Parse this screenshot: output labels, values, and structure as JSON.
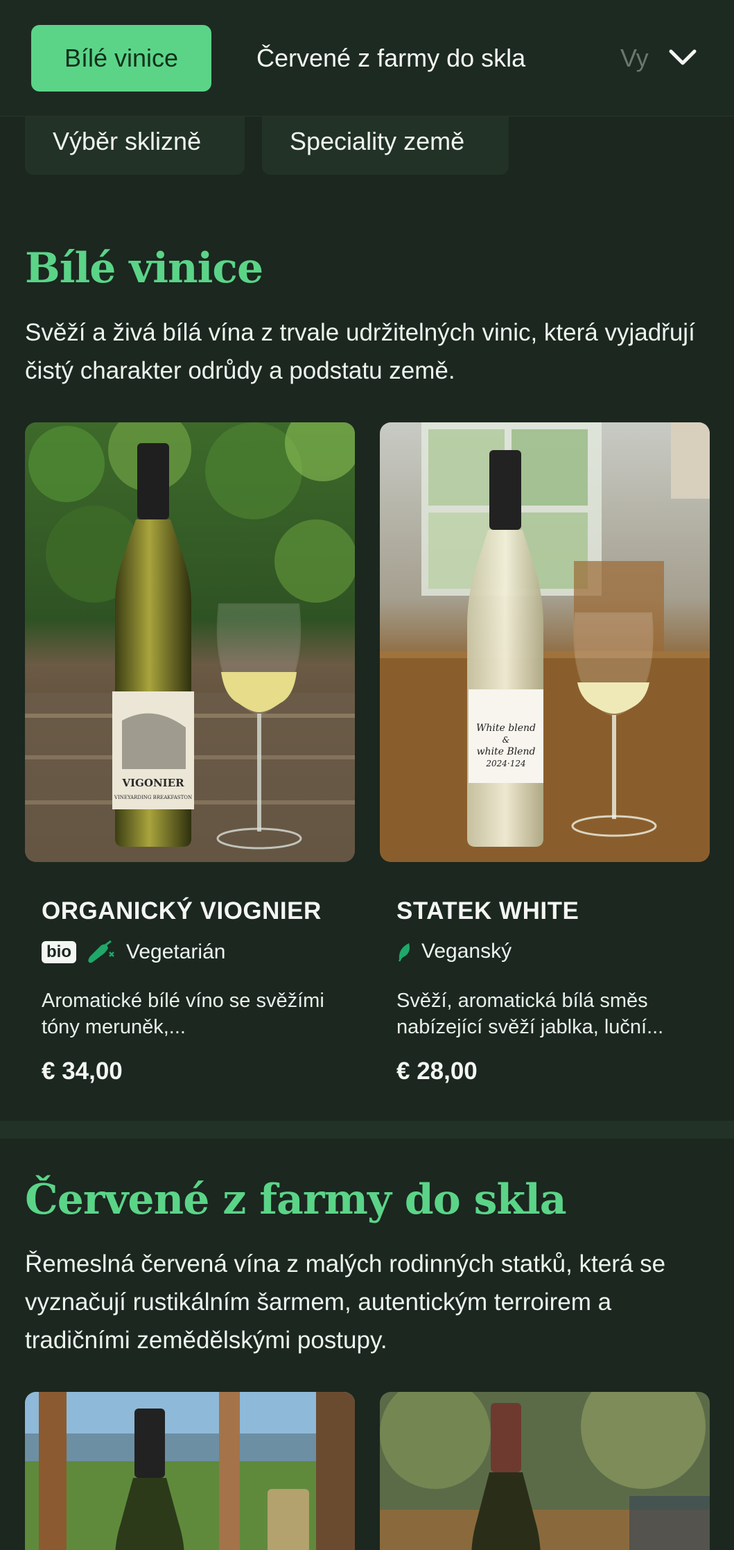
{
  "nav": {
    "tabs": [
      {
        "label": "Bílé vinice"
      },
      {
        "label": "Červené z farmy do skla"
      },
      {
        "label": "Vy"
      }
    ],
    "chips": [
      {
        "label": "Výběr sklizně"
      },
      {
        "label": "Speciality země"
      }
    ]
  },
  "sections": [
    {
      "title": "Bílé vinice",
      "description": "Svěží a živá bílá vína z trvale udržitelných vinic, která vyjadřují čistý charakter odrůdy a podstatu země.",
      "products": [
        {
          "name": "ORGANICKÝ VIOGNIER",
          "badge": "bio",
          "diet": "Vegetarián",
          "description": "Aromatické bílé víno se svěžími tóny meruněk,...",
          "price": "€ 34,00",
          "label_text": "VIGONIER",
          "label_sub": "VINEYARDING BREAKFASTON"
        },
        {
          "name": "STATEK WHITE",
          "diet": "Veganský",
          "description": "Svěží, aromatická bílá směs nabízející svěží jablka, luční...",
          "price": "€ 28,00",
          "label_text": "White blend & white Blend 2024·124"
        }
      ]
    },
    {
      "title": "Červené z farmy do skla",
      "description": "Řemeslná červená vína z malých rodinných statků, která se vyznačují rustikálním šarmem, autentickým terroirem a tradičními zemědělskými postupy."
    }
  ],
  "icons": {
    "chevron": "chevron-down-icon",
    "vegetarian": "vegetarian-carrot-icon",
    "vegan": "vegan-leaf-icon"
  },
  "colors": {
    "background": "#1b271f",
    "accent": "#5bd488",
    "chip": "#223226"
  }
}
